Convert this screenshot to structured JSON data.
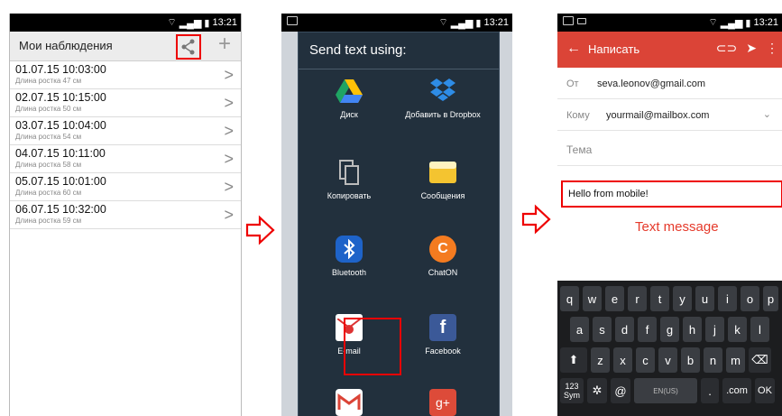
{
  "status": {
    "time": "13:21"
  },
  "screen1": {
    "title": "Мои наблюдения",
    "plus": "+",
    "rows": [
      {
        "date": "01.07.15 10:03:00",
        "sub": "Длина ростка 47 см"
      },
      {
        "date": "02.07.15 10:15:00",
        "sub": "Длина ростка 50 см"
      },
      {
        "date": "03.07.15 10:04:00",
        "sub": "Длина ростка 54 см"
      },
      {
        "date": "04.07.15 10:11:00",
        "sub": "Длина ростка 58 см"
      },
      {
        "date": "05.07.15 10:01:00",
        "sub": "Длина ростка 60 см"
      },
      {
        "date": "06.07.15 10:32:00",
        "sub": "Длина ростка 59 см"
      }
    ]
  },
  "screen2": {
    "title": "Send text using:",
    "apps": [
      {
        "label": "Диск",
        "icon": "drive-icon"
      },
      {
        "label": "Добавить в Dropbox",
        "icon": "dropbox-icon"
      },
      {
        "label": "Копировать",
        "icon": "copy-icon"
      },
      {
        "label": "Сообщения",
        "icon": "messages-icon"
      },
      {
        "label": "Bluetooth",
        "icon": "bluetooth-icon"
      },
      {
        "label": "ChatON",
        "icon": "chaton-icon"
      },
      {
        "label": "E-mail",
        "icon": "email-icon"
      },
      {
        "label": "Facebook",
        "icon": "facebook-icon"
      },
      {
        "label": "",
        "icon": "gmail-icon"
      },
      {
        "label": "",
        "icon": "googleplus-icon"
      }
    ]
  },
  "screen3": {
    "title": "Написать",
    "from_label": "От",
    "from_value": "seva.leonov@gmail.com",
    "to_label": "Кому",
    "to_value": "yourmail@mailbox.com",
    "subject_placeholder": "Тема",
    "message": "Hello from mobile!",
    "caption": "Text message",
    "keyboard": {
      "row1": [
        "q",
        "w",
        "e",
        "r",
        "t",
        "y",
        "u",
        "i",
        "o",
        "p"
      ],
      "row2": [
        "a",
        "s",
        "d",
        "f",
        "g",
        "h",
        "j",
        "k",
        "l"
      ],
      "row3": [
        "z",
        "x",
        "c",
        "v",
        "b",
        "n",
        "m"
      ],
      "sym": "123 Sym",
      "at": "@",
      "lang": "EN(US)",
      "dot": ".",
      "com": ".com",
      "ok": "OK"
    }
  },
  "colors": {
    "highlight": "#ee0000",
    "gmail_red": "#db4437",
    "caption": "#e53a2b"
  }
}
